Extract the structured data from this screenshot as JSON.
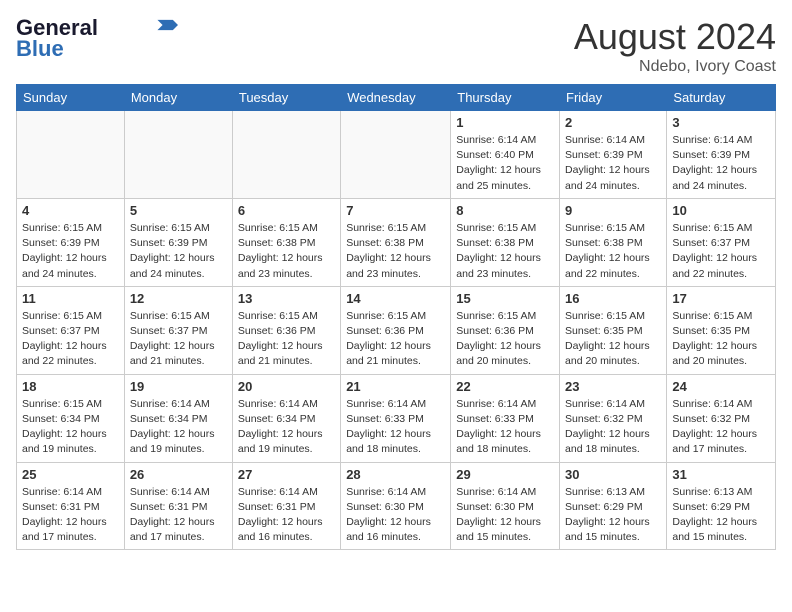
{
  "header": {
    "logo_general": "General",
    "logo_blue": "Blue",
    "month_year": "August 2024",
    "location": "Ndebo, Ivory Coast"
  },
  "days_of_week": [
    "Sunday",
    "Monday",
    "Tuesday",
    "Wednesday",
    "Thursday",
    "Friday",
    "Saturday"
  ],
  "weeks": [
    [
      {
        "day": "",
        "info": ""
      },
      {
        "day": "",
        "info": ""
      },
      {
        "day": "",
        "info": ""
      },
      {
        "day": "",
        "info": ""
      },
      {
        "day": "1",
        "info": "Sunrise: 6:14 AM\nSunset: 6:40 PM\nDaylight: 12 hours\nand 25 minutes."
      },
      {
        "day": "2",
        "info": "Sunrise: 6:14 AM\nSunset: 6:39 PM\nDaylight: 12 hours\nand 24 minutes."
      },
      {
        "day": "3",
        "info": "Sunrise: 6:14 AM\nSunset: 6:39 PM\nDaylight: 12 hours\nand 24 minutes."
      }
    ],
    [
      {
        "day": "4",
        "info": "Sunrise: 6:15 AM\nSunset: 6:39 PM\nDaylight: 12 hours\nand 24 minutes."
      },
      {
        "day": "5",
        "info": "Sunrise: 6:15 AM\nSunset: 6:39 PM\nDaylight: 12 hours\nand 24 minutes."
      },
      {
        "day": "6",
        "info": "Sunrise: 6:15 AM\nSunset: 6:38 PM\nDaylight: 12 hours\nand 23 minutes."
      },
      {
        "day": "7",
        "info": "Sunrise: 6:15 AM\nSunset: 6:38 PM\nDaylight: 12 hours\nand 23 minutes."
      },
      {
        "day": "8",
        "info": "Sunrise: 6:15 AM\nSunset: 6:38 PM\nDaylight: 12 hours\nand 23 minutes."
      },
      {
        "day": "9",
        "info": "Sunrise: 6:15 AM\nSunset: 6:38 PM\nDaylight: 12 hours\nand 22 minutes."
      },
      {
        "day": "10",
        "info": "Sunrise: 6:15 AM\nSunset: 6:37 PM\nDaylight: 12 hours\nand 22 minutes."
      }
    ],
    [
      {
        "day": "11",
        "info": "Sunrise: 6:15 AM\nSunset: 6:37 PM\nDaylight: 12 hours\nand 22 minutes."
      },
      {
        "day": "12",
        "info": "Sunrise: 6:15 AM\nSunset: 6:37 PM\nDaylight: 12 hours\nand 21 minutes."
      },
      {
        "day": "13",
        "info": "Sunrise: 6:15 AM\nSunset: 6:36 PM\nDaylight: 12 hours\nand 21 minutes."
      },
      {
        "day": "14",
        "info": "Sunrise: 6:15 AM\nSunset: 6:36 PM\nDaylight: 12 hours\nand 21 minutes."
      },
      {
        "day": "15",
        "info": "Sunrise: 6:15 AM\nSunset: 6:36 PM\nDaylight: 12 hours\nand 20 minutes."
      },
      {
        "day": "16",
        "info": "Sunrise: 6:15 AM\nSunset: 6:35 PM\nDaylight: 12 hours\nand 20 minutes."
      },
      {
        "day": "17",
        "info": "Sunrise: 6:15 AM\nSunset: 6:35 PM\nDaylight: 12 hours\nand 20 minutes."
      }
    ],
    [
      {
        "day": "18",
        "info": "Sunrise: 6:15 AM\nSunset: 6:34 PM\nDaylight: 12 hours\nand 19 minutes."
      },
      {
        "day": "19",
        "info": "Sunrise: 6:14 AM\nSunset: 6:34 PM\nDaylight: 12 hours\nand 19 minutes."
      },
      {
        "day": "20",
        "info": "Sunrise: 6:14 AM\nSunset: 6:34 PM\nDaylight: 12 hours\nand 19 minutes."
      },
      {
        "day": "21",
        "info": "Sunrise: 6:14 AM\nSunset: 6:33 PM\nDaylight: 12 hours\nand 18 minutes."
      },
      {
        "day": "22",
        "info": "Sunrise: 6:14 AM\nSunset: 6:33 PM\nDaylight: 12 hours\nand 18 minutes."
      },
      {
        "day": "23",
        "info": "Sunrise: 6:14 AM\nSunset: 6:32 PM\nDaylight: 12 hours\nand 18 minutes."
      },
      {
        "day": "24",
        "info": "Sunrise: 6:14 AM\nSunset: 6:32 PM\nDaylight: 12 hours\nand 17 minutes."
      }
    ],
    [
      {
        "day": "25",
        "info": "Sunrise: 6:14 AM\nSunset: 6:31 PM\nDaylight: 12 hours\nand 17 minutes."
      },
      {
        "day": "26",
        "info": "Sunrise: 6:14 AM\nSunset: 6:31 PM\nDaylight: 12 hours\nand 17 minutes."
      },
      {
        "day": "27",
        "info": "Sunrise: 6:14 AM\nSunset: 6:31 PM\nDaylight: 12 hours\nand 16 minutes."
      },
      {
        "day": "28",
        "info": "Sunrise: 6:14 AM\nSunset: 6:30 PM\nDaylight: 12 hours\nand 16 minutes."
      },
      {
        "day": "29",
        "info": "Sunrise: 6:14 AM\nSunset: 6:30 PM\nDaylight: 12 hours\nand 15 minutes."
      },
      {
        "day": "30",
        "info": "Sunrise: 6:13 AM\nSunset: 6:29 PM\nDaylight: 12 hours\nand 15 minutes."
      },
      {
        "day": "31",
        "info": "Sunrise: 6:13 AM\nSunset: 6:29 PM\nDaylight: 12 hours\nand 15 minutes."
      }
    ]
  ]
}
